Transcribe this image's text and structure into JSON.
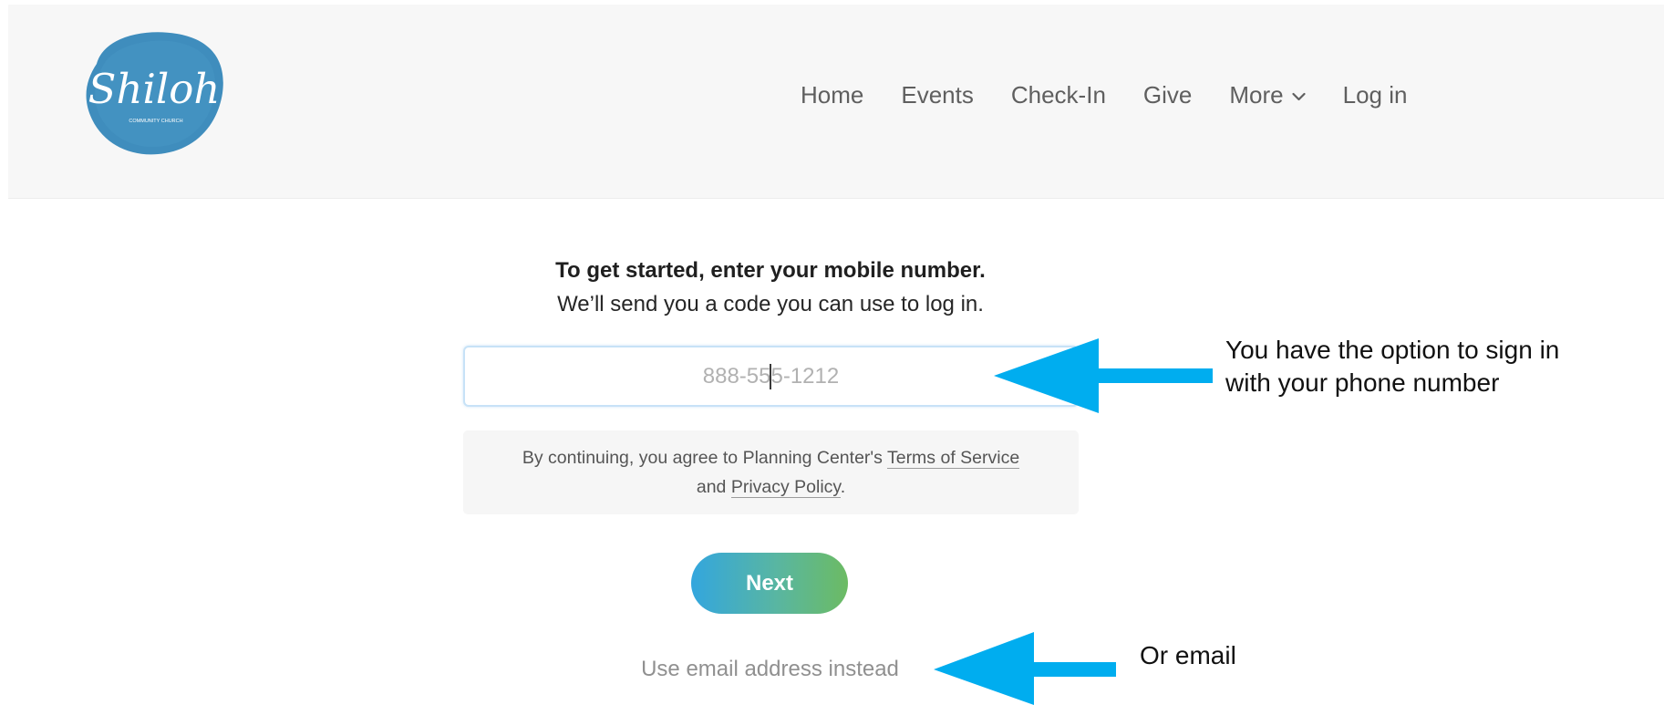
{
  "header": {
    "logo_text": "Shiloh",
    "logo_subtext": "COMMUNITY CHURCH",
    "nav": [
      {
        "label": "Home"
      },
      {
        "label": "Events"
      },
      {
        "label": "Check-In"
      },
      {
        "label": "Give"
      },
      {
        "label": "More"
      },
      {
        "label": "Log in"
      }
    ]
  },
  "login": {
    "title": "To get started, enter your mobile number.",
    "subtitle": "We’ll send you a code you can use to log in.",
    "phone_placeholder": "888-555-1212",
    "terms_prefix": "By continuing, you agree to Planning Center's",
    "terms_link": "Terms of Service",
    "terms_middle": "and",
    "privacy_link": "Privacy Policy",
    "terms_suffix": ".",
    "next_label": "Next",
    "email_link": "Use email address instead"
  },
  "annotations": {
    "phone_note_line1": "You have the option to sign in",
    "phone_note_line2": "with your phone number",
    "email_note": "Or email",
    "arrow_color": "#00adef"
  },
  "colors": {
    "logo_blue": "#3f8dbd",
    "nav_text": "#5f5f5f",
    "button_gradient_start": "#33a6de",
    "button_gradient_end": "#6cbb63"
  }
}
